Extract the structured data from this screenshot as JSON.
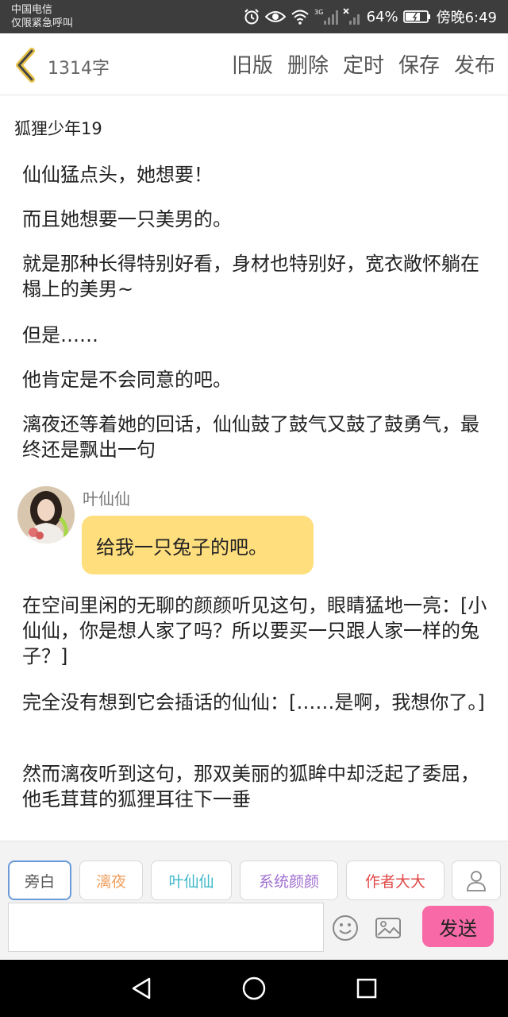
{
  "status_bar": {
    "carrier_line1": "中国电信",
    "carrier_line2": "仅限紧急呼叫",
    "network": "3G",
    "battery": "64%",
    "time": "傍晚6:49",
    "icons": [
      "alarm-icon",
      "eye-icon",
      "wifi-icon",
      "signal-icon",
      "no-signal-icon",
      "battery-icon"
    ]
  },
  "header": {
    "word_count": "1314字",
    "actions": [
      "旧版",
      "删除",
      "定时",
      "保存",
      "发布"
    ],
    "back_icon": "chevron-left-icon"
  },
  "title": "狐狸少年19",
  "paragraphs": [
    "仙仙猛点头，她想要！",
    "而且她想要一只美男的。",
    "就是那种长得特别好看，身材也特别好，宽衣敞怀躺在榻上的美男~",
    "但是……",
    "他肯定是不会同意的吧。",
    "漓夜还等着她的回话，仙仙鼓了鼓气又鼓了鼓勇气，最终还是飘出一句"
  ],
  "chat": {
    "speaker": "叶仙仙",
    "message": "给我一只兔子的吧。"
  },
  "paragraphs_after": [
    "在空间里闲的无聊的颜颜听见这句，眼睛猛地一亮：[小仙仙，你是想人家了吗？所以要买一只跟人家一样的兔子？]",
    "完全没有想到它会插话的仙仙：[……是啊，我想你了。]",
    "然而漓夜听到这句，那双美丽的狐眸中却泛起了委屈，他毛茸茸的狐狸耳往下一垂"
  ],
  "roles": [
    {
      "label": "旁白",
      "color": "#555555"
    },
    {
      "label": "漓夜",
      "color": "#f0a060"
    },
    {
      "label": "叶仙仙",
      "color": "#3cb8c8"
    },
    {
      "label": "系统颜颜",
      "color": "#a070d0"
    },
    {
      "label": "作者大大",
      "color": "#e04848"
    }
  ],
  "composer": {
    "input_value": "",
    "send_label": "发送"
  },
  "colors": {
    "bubble": "#fede7d",
    "send": "#f76aa7",
    "active_role_border": "#6a9bd8"
  }
}
